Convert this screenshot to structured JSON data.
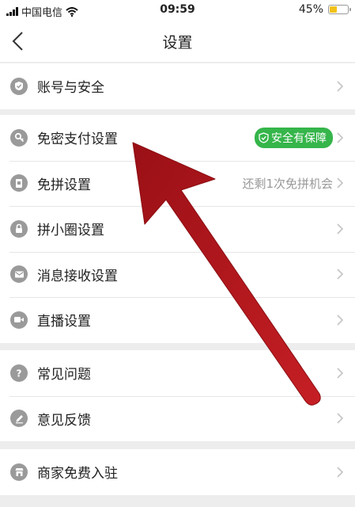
{
  "status_bar": {
    "carrier": "中国电信",
    "time": "09:59",
    "battery": "45%",
    "battery_level": 0.45
  },
  "nav": {
    "title": "设置"
  },
  "groups": [
    {
      "items": [
        {
          "label": "账号与安全",
          "icon": "shield-check-icon"
        }
      ]
    },
    {
      "items": [
        {
          "label": "免密支付设置",
          "icon": "key-icon",
          "badge": "安全有保障"
        },
        {
          "label": "免拼设置",
          "icon": "ticket-icon",
          "hint": "还剩1次免拼机会"
        },
        {
          "label": "拼小圈设置",
          "icon": "lock-icon"
        },
        {
          "label": "消息接收设置",
          "icon": "envelope-icon"
        },
        {
          "label": "直播设置",
          "icon": "video-camera-icon"
        }
      ]
    },
    {
      "items": [
        {
          "label": "常见问题",
          "icon": "question-icon"
        },
        {
          "label": "意见反馈",
          "icon": "pencil-icon"
        }
      ]
    },
    {
      "items": [
        {
          "label": "商家免费入驻",
          "icon": "store-icon"
        }
      ]
    }
  ],
  "colors": {
    "accent_green": "#35b54a",
    "annotation_arrow": "#b8161d",
    "icon_gray": "#9a9a9a"
  }
}
